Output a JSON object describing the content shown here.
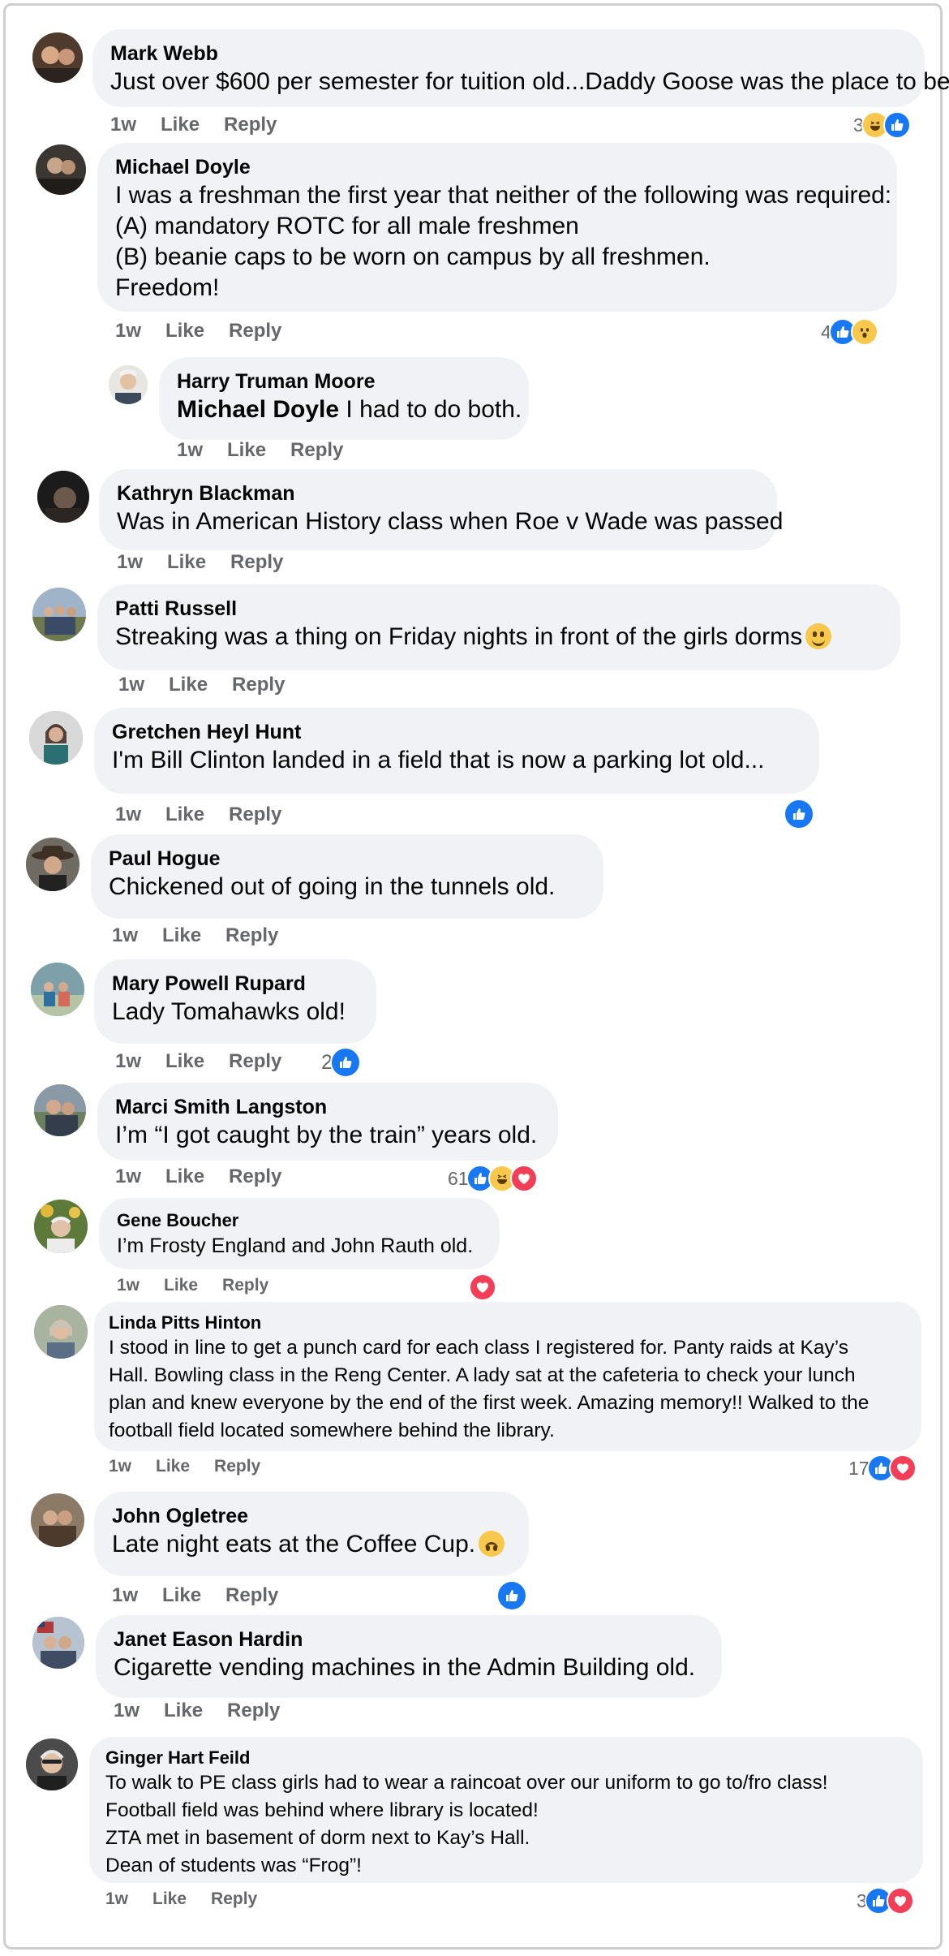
{
  "comments": [
    {
      "author": "Mark Webb",
      "lines": [
        "Just over $600 per semester for tuition old...Daddy Goose was the place to be"
      ],
      "time": "1w",
      "like": "Like",
      "reply": "Reply",
      "react_count": "3",
      "reactions": [
        "haha-icon",
        "like-icon"
      ]
    },
    {
      "author": "Michael Doyle",
      "lines": [
        "I was a freshman the first year that neither of the following was required:",
        "(A) mandatory ROTC for all male freshmen",
        "(B) beanie caps to be worn on campus by all freshmen.",
        "Freedom!"
      ],
      "time": "1w",
      "like": "Like",
      "reply": "Reply",
      "react_count": "4",
      "reactions": [
        "like-icon",
        "wow-icon"
      ]
    },
    {
      "author": "Harry Truman Moore",
      "mention": "Michael Doyle",
      "lines": [
        " I had to do both."
      ],
      "time": "1w",
      "like": "Like",
      "reply": "Reply"
    },
    {
      "author": "Kathryn Blackman",
      "lines": [
        "Was in American History class when Roe v Wade was passed"
      ],
      "time": "1w",
      "like": "Like",
      "reply": "Reply"
    },
    {
      "author": "Patti Russell",
      "lines": [
        "Streaking was a thing on Friday nights in front of the girls dorms"
      ],
      "time": "1w",
      "like": "Like",
      "reply": "Reply"
    },
    {
      "author": "Gretchen Heyl Hunt",
      "lines": [
        "I'm Bill Clinton landed in a field that is now a parking lot old..."
      ],
      "time": "1w",
      "like": "Like",
      "reply": "Reply",
      "reactions": [
        "like-icon"
      ]
    },
    {
      "author": "Paul Hogue",
      "lines": [
        "Chickened out of going in the tunnels old."
      ],
      "time": "1w",
      "like": "Like",
      "reply": "Reply"
    },
    {
      "author": "Mary Powell Rupard",
      "lines": [
        "Lady Tomahawks old!"
      ],
      "time": "1w",
      "like": "Like",
      "reply": "Reply",
      "react_count": "2",
      "reactions": [
        "like-icon"
      ]
    },
    {
      "author": "Marci Smith Langston",
      "lines": [
        "I’m “I got caught by the train” years old."
      ],
      "time": "1w",
      "like": "Like",
      "reply": "Reply",
      "react_count": "61",
      "reactions": [
        "like-icon",
        "haha-icon",
        "love-icon"
      ]
    },
    {
      "author": "Gene Boucher",
      "lines": [
        "I’m Frosty England and John Rauth old."
      ],
      "time": "1w",
      "like": "Like",
      "reply": "Reply",
      "reactions": [
        "love-icon"
      ]
    },
    {
      "author": "Linda Pitts Hinton",
      "lines": [
        "I stood in line to get a punch card for each class I registered for. Panty raids at Kay’s",
        "Hall. Bowling class in the Reng Center. A lady sat at the cafeteria to check your lunch",
        "plan and knew everyone by the end of the first week. Amazing memory!! Walked to the",
        "football field located somewhere behind the library."
      ],
      "time": "1w",
      "like": "Like",
      "reply": "Reply",
      "react_count": "17",
      "reactions": [
        "like-icon",
        "love-icon"
      ]
    },
    {
      "author": "John Ogletree",
      "lines": [
        "Late night eats at the Coffee Cup."
      ],
      "time": "1w",
      "like": "Like",
      "reply": "Reply",
      "reactions": [
        "like-icon"
      ]
    },
    {
      "author": "Janet Eason Hardin",
      "lines": [
        "Cigarette vending machines in the Admin Building old."
      ],
      "time": "1w",
      "like": "Like",
      "reply": "Reply"
    },
    {
      "author": "Ginger Hart Feild",
      "lines": [
        "To walk to PE class girls had to wear a raincoat over our uniform to go to/fro class!",
        "Football field was behind where library is located!",
        "ZTA met in basement of dorm next to Kay’s Hall.",
        "Dean of students was “Frog”!"
      ],
      "time": "1w",
      "like": "Like",
      "reply": "Reply",
      "react_count": "3",
      "reactions": [
        "like-icon",
        "love-icon"
      ]
    }
  ]
}
